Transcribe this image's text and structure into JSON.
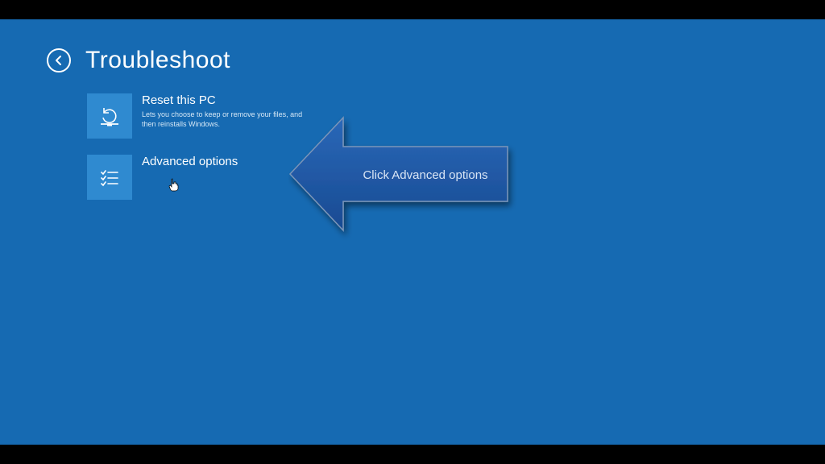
{
  "header": {
    "title": "Troubleshoot"
  },
  "options": {
    "reset": {
      "title": "Reset this PC",
      "desc": "Lets you choose to keep or remove your files, and then reinstalls Windows."
    },
    "advanced": {
      "title": "Advanced options"
    }
  },
  "callout": {
    "text": "Click Advanced options"
  },
  "colors": {
    "background": "#166ab2",
    "tile": "#2f8ad0",
    "calloutFill": "#1f58a8",
    "calloutStroke": "#7b95b8"
  }
}
